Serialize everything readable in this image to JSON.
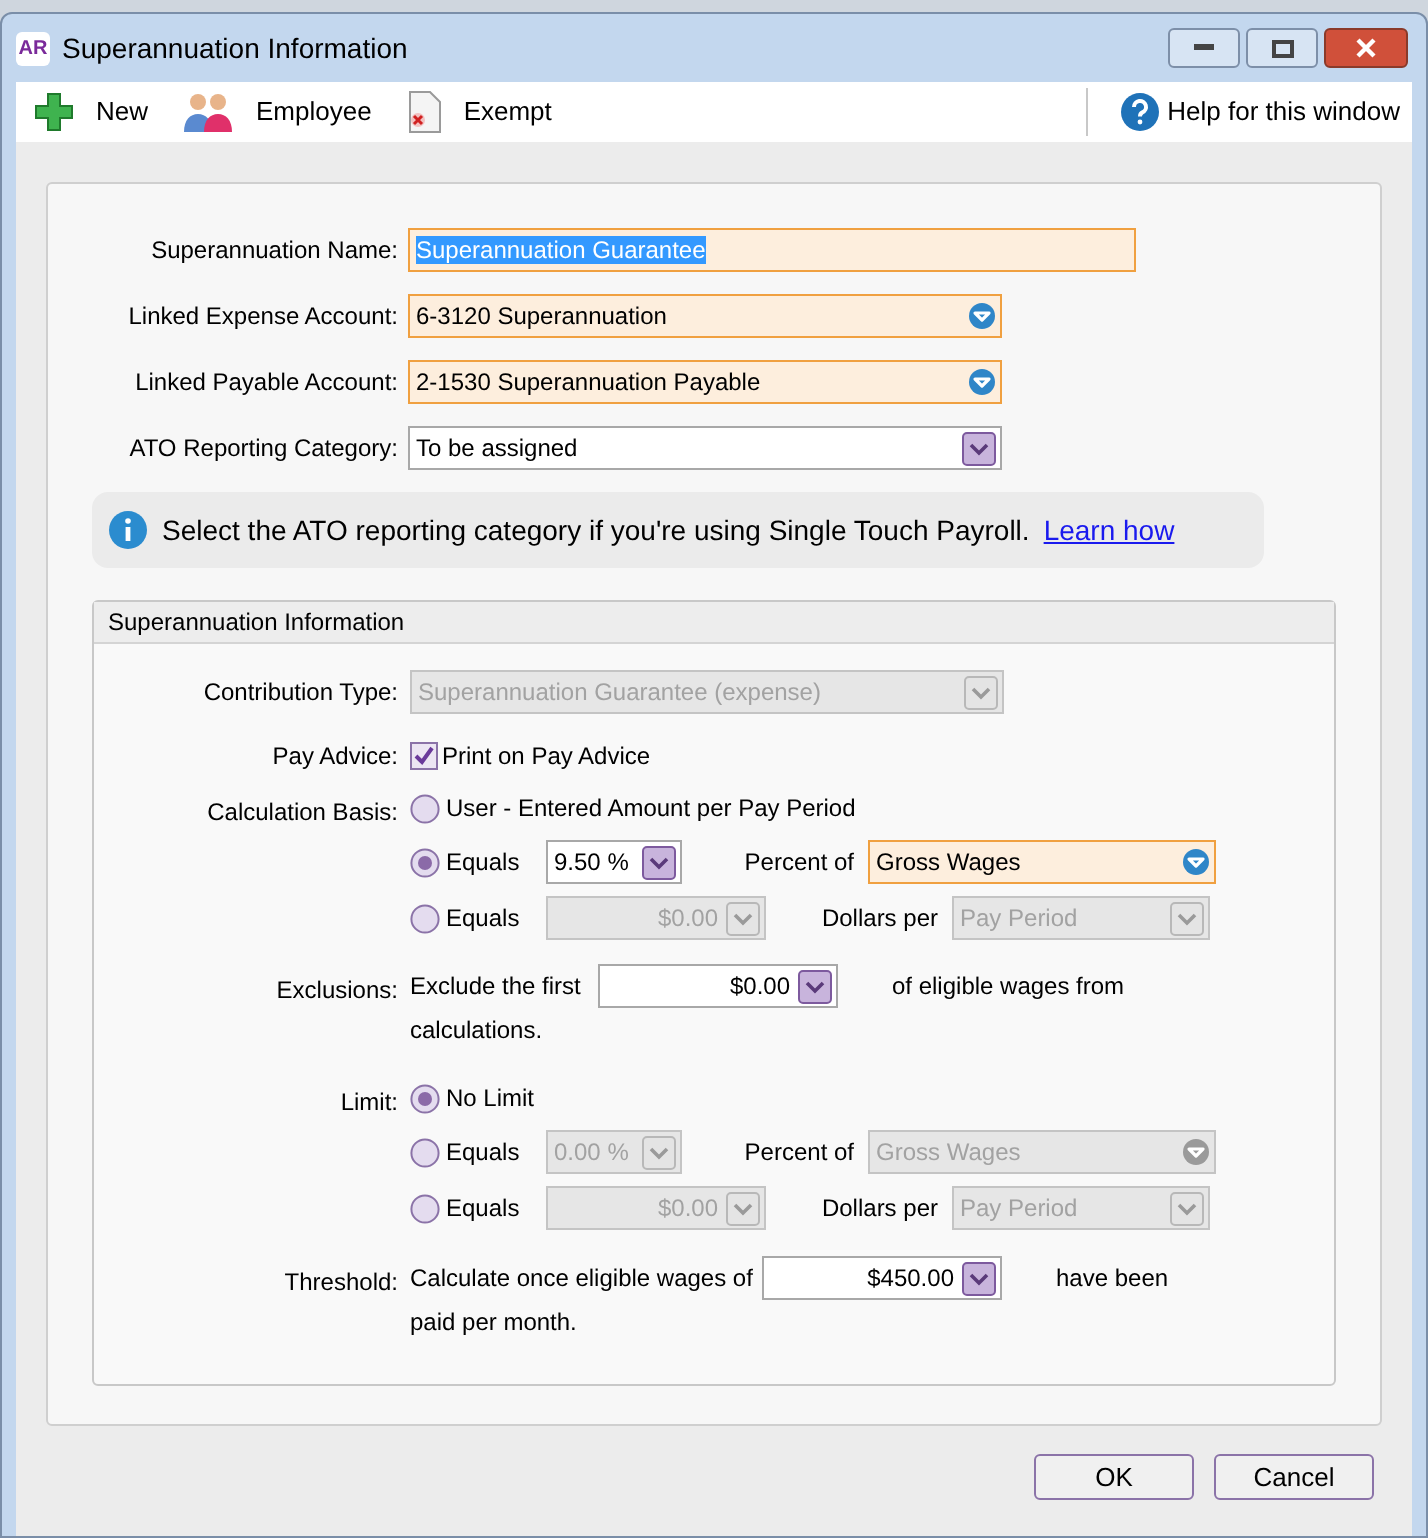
{
  "window": {
    "title": "Superannuation Information",
    "app_badge": "AR"
  },
  "toolbar": {
    "items": [
      {
        "kind": "new",
        "label": "New"
      },
      {
        "kind": "employee",
        "label": "Employee"
      },
      {
        "kind": "exempt",
        "label": "Exempt"
      }
    ],
    "help": {
      "label": "Help for this window"
    }
  },
  "form": {
    "fields": [
      {
        "label": "Superannuation Name:",
        "kind": "text",
        "value": "Superannuation Guarantee",
        "highlighted": true,
        "text_selected": true
      },
      {
        "label": "Linked Expense Account:",
        "kind": "account",
        "value": "6-3120 Superannuation",
        "highlighted": true
      },
      {
        "label": "Linked Payable Account:",
        "kind": "account",
        "value": "2-1530 Superannuation Payable",
        "highlighted": true
      },
      {
        "label": "ATO Reporting Category:",
        "kind": "select",
        "value": "To be assigned",
        "highlighted": false
      }
    ]
  },
  "notice": {
    "text": "Select the ATO reporting category if you're using Single Touch Payroll.",
    "link": "Learn how"
  },
  "section": {
    "title": "Superannuation Information",
    "contribution_type": {
      "label": "Contribution Type:",
      "value": "Superannuation Guarantee (expense)",
      "disabled": true
    },
    "pay_advice": {
      "label": "Pay Advice:",
      "option": "Print on Pay Advice",
      "checked": true
    },
    "calculation_basis": {
      "label": "Calculation Basis:",
      "options": [
        {
          "kind": "plain",
          "label": "User - Entered Amount per Pay Period",
          "selected": false
        },
        {
          "kind": "percent",
          "label": "Equals",
          "amount": {
            "value": "9.50 %",
            "disabled": false
          },
          "unit": "Percent of",
          "basis": {
            "kind": "account",
            "value": "Gross Wages",
            "highlighted": true,
            "disabled": false
          },
          "selected": true
        },
        {
          "kind": "dollars",
          "label": "Equals",
          "amount": {
            "value": "$0.00",
            "disabled": true
          },
          "unit": "Dollars per",
          "basis": {
            "kind": "select",
            "value": "Pay Period",
            "disabled": true
          },
          "selected": false
        }
      ]
    },
    "exclusions": {
      "label": "Exclusions:",
      "before": "Exclude the first",
      "amount": {
        "value": "$0.00",
        "disabled": false
      },
      "after": "of eligible wages from",
      "continuation": "calculations."
    },
    "limit": {
      "label": "Limit:",
      "options": [
        {
          "kind": "plain",
          "label": "No Limit",
          "selected": true
        },
        {
          "kind": "percent",
          "label": "Equals",
          "amount": {
            "value": "0.00 %",
            "disabled": true
          },
          "unit": "Percent of",
          "basis": {
            "kind": "account",
            "value": "Gross Wages",
            "disabled": true
          },
          "selected": false
        },
        {
          "kind": "dollars",
          "label": "Equals",
          "amount": {
            "value": "$0.00",
            "disabled": true
          },
          "unit": "Dollars per",
          "basis": {
            "kind": "select",
            "value": "Pay Period",
            "disabled": true
          },
          "selected": false
        }
      ]
    },
    "threshold": {
      "label": "Threshold:",
      "before": "Calculate once eligible wages of",
      "amount": {
        "value": "$450.00",
        "disabled": false
      },
      "after": "have been",
      "continuation": "paid per month."
    }
  },
  "buttons": [
    {
      "label": "OK"
    },
    {
      "label": "Cancel"
    }
  ]
}
